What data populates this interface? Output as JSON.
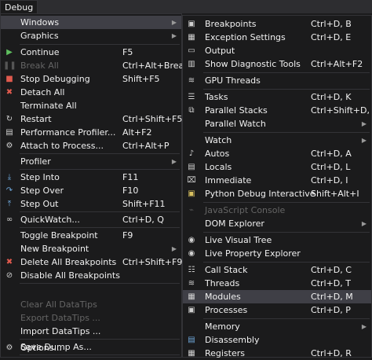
{
  "menubar": {
    "debug_label": "Debug"
  },
  "debug_menu": {
    "windows": "Windows",
    "graphics": "Graphics",
    "continue": {
      "label": "Continue",
      "shortcut": "F5"
    },
    "break_all": {
      "label": "Break All",
      "shortcut": "Ctrl+Alt+Break"
    },
    "stop_debugging": {
      "label": "Stop Debugging",
      "shortcut": "Shift+F5"
    },
    "detach_all": {
      "label": "Detach All"
    },
    "terminate_all": {
      "label": "Terminate All"
    },
    "restart": {
      "label": "Restart",
      "shortcut": "Ctrl+Shift+F5"
    },
    "performance_profiler": {
      "label": "Performance Profiler...",
      "shortcut": "Alt+F2"
    },
    "attach_to_process": {
      "label": "Attach to Process...",
      "shortcut": "Ctrl+Alt+P"
    },
    "profiler": "Profiler",
    "step_into": {
      "label": "Step Into",
      "shortcut": "F11"
    },
    "step_over": {
      "label": "Step Over",
      "shortcut": "F10"
    },
    "step_out": {
      "label": "Step Out",
      "shortcut": "Shift+F11"
    },
    "quickwatch": {
      "label": "QuickWatch...",
      "shortcut": "Ctrl+D, Q"
    },
    "toggle_breakpoint": {
      "label": "Toggle Breakpoint",
      "shortcut": "F9"
    },
    "new_breakpoint": "New Breakpoint",
    "delete_all_breakpoints": {
      "label": "Delete All Breakpoints",
      "shortcut": "Ctrl+Shift+F9"
    },
    "disable_all_breakpoints": {
      "label": "Disable All Breakpoints"
    },
    "clear_all_datatips": {
      "label": "Clear All DataTips"
    },
    "export_datatips": {
      "label": "Export DataTips ..."
    },
    "import_datatips": {
      "label": "Import DataTips ..."
    },
    "save_dump": {
      "label": "Save Dump As..."
    },
    "options": {
      "label": "Options..."
    }
  },
  "windows_submenu": {
    "breakpoints": {
      "label": "Breakpoints",
      "shortcut": "Ctrl+D, B"
    },
    "exception_settings": {
      "label": "Exception Settings",
      "shortcut": "Ctrl+D, E"
    },
    "output": {
      "label": "Output"
    },
    "show_diagnostic_tools": {
      "label": "Show Diagnostic Tools",
      "shortcut": "Ctrl+Alt+F2"
    },
    "gpu_threads": {
      "label": "GPU Threads"
    },
    "tasks": {
      "label": "Tasks",
      "shortcut": "Ctrl+D, K"
    },
    "parallel_stacks": {
      "label": "Parallel Stacks",
      "shortcut": "Ctrl+Shift+D, S"
    },
    "parallel_watch": "Parallel Watch",
    "watch": "Watch",
    "autos": {
      "label": "Autos",
      "shortcut": "Ctrl+D, A"
    },
    "locals": {
      "label": "Locals",
      "shortcut": "Ctrl+D, L"
    },
    "immediate": {
      "label": "Immediate",
      "shortcut": "Ctrl+D, I"
    },
    "python_debug_interactive": {
      "label": "Python Debug Interactive",
      "shortcut": "Shift+Alt+I"
    },
    "javascript_console": {
      "label": "JavaScript Console"
    },
    "dom_explorer": "DOM Explorer",
    "live_visual_tree": {
      "label": "Live Visual Tree"
    },
    "live_property_explorer": {
      "label": "Live Property Explorer"
    },
    "call_stack": {
      "label": "Call Stack",
      "shortcut": "Ctrl+D, C"
    },
    "threads": {
      "label": "Threads",
      "shortcut": "Ctrl+D, T"
    },
    "modules": {
      "label": "Modules",
      "shortcut": "Ctrl+D, M"
    },
    "processes": {
      "label": "Processes",
      "shortcut": "Ctrl+D, P"
    },
    "memory": "Memory",
    "disassembly": {
      "label": "Disassembly"
    },
    "registers": {
      "label": "Registers",
      "shortcut": "Ctrl+D, R"
    }
  }
}
